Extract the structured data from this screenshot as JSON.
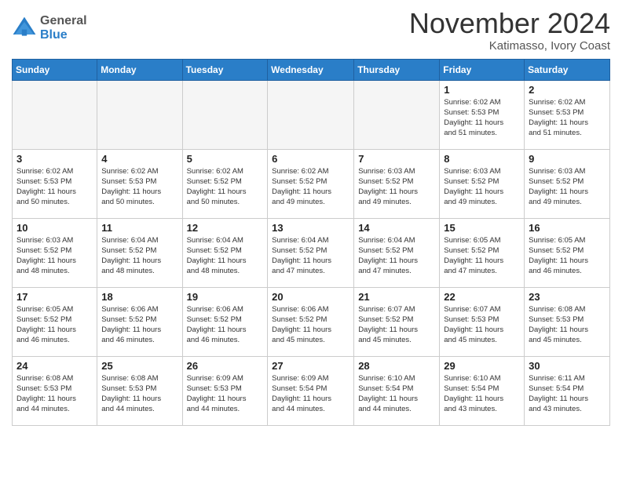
{
  "header": {
    "logo_line1": "General",
    "logo_line2": "Blue",
    "month": "November 2024",
    "location": "Katimasso, Ivory Coast"
  },
  "weekdays": [
    "Sunday",
    "Monday",
    "Tuesday",
    "Wednesday",
    "Thursday",
    "Friday",
    "Saturday"
  ],
  "weeks": [
    [
      {
        "day": "",
        "info": ""
      },
      {
        "day": "",
        "info": ""
      },
      {
        "day": "",
        "info": ""
      },
      {
        "day": "",
        "info": ""
      },
      {
        "day": "",
        "info": ""
      },
      {
        "day": "1",
        "info": "Sunrise: 6:02 AM\nSunset: 5:53 PM\nDaylight: 11 hours\nand 51 minutes."
      },
      {
        "day": "2",
        "info": "Sunrise: 6:02 AM\nSunset: 5:53 PM\nDaylight: 11 hours\nand 51 minutes."
      }
    ],
    [
      {
        "day": "3",
        "info": "Sunrise: 6:02 AM\nSunset: 5:53 PM\nDaylight: 11 hours\nand 50 minutes."
      },
      {
        "day": "4",
        "info": "Sunrise: 6:02 AM\nSunset: 5:53 PM\nDaylight: 11 hours\nand 50 minutes."
      },
      {
        "day": "5",
        "info": "Sunrise: 6:02 AM\nSunset: 5:52 PM\nDaylight: 11 hours\nand 50 minutes."
      },
      {
        "day": "6",
        "info": "Sunrise: 6:02 AM\nSunset: 5:52 PM\nDaylight: 11 hours\nand 49 minutes."
      },
      {
        "day": "7",
        "info": "Sunrise: 6:03 AM\nSunset: 5:52 PM\nDaylight: 11 hours\nand 49 minutes."
      },
      {
        "day": "8",
        "info": "Sunrise: 6:03 AM\nSunset: 5:52 PM\nDaylight: 11 hours\nand 49 minutes."
      },
      {
        "day": "9",
        "info": "Sunrise: 6:03 AM\nSunset: 5:52 PM\nDaylight: 11 hours\nand 49 minutes."
      }
    ],
    [
      {
        "day": "10",
        "info": "Sunrise: 6:03 AM\nSunset: 5:52 PM\nDaylight: 11 hours\nand 48 minutes."
      },
      {
        "day": "11",
        "info": "Sunrise: 6:04 AM\nSunset: 5:52 PM\nDaylight: 11 hours\nand 48 minutes."
      },
      {
        "day": "12",
        "info": "Sunrise: 6:04 AM\nSunset: 5:52 PM\nDaylight: 11 hours\nand 48 minutes."
      },
      {
        "day": "13",
        "info": "Sunrise: 6:04 AM\nSunset: 5:52 PM\nDaylight: 11 hours\nand 47 minutes."
      },
      {
        "day": "14",
        "info": "Sunrise: 6:04 AM\nSunset: 5:52 PM\nDaylight: 11 hours\nand 47 minutes."
      },
      {
        "day": "15",
        "info": "Sunrise: 6:05 AM\nSunset: 5:52 PM\nDaylight: 11 hours\nand 47 minutes."
      },
      {
        "day": "16",
        "info": "Sunrise: 6:05 AM\nSunset: 5:52 PM\nDaylight: 11 hours\nand 46 minutes."
      }
    ],
    [
      {
        "day": "17",
        "info": "Sunrise: 6:05 AM\nSunset: 5:52 PM\nDaylight: 11 hours\nand 46 minutes."
      },
      {
        "day": "18",
        "info": "Sunrise: 6:06 AM\nSunset: 5:52 PM\nDaylight: 11 hours\nand 46 minutes."
      },
      {
        "day": "19",
        "info": "Sunrise: 6:06 AM\nSunset: 5:52 PM\nDaylight: 11 hours\nand 46 minutes."
      },
      {
        "day": "20",
        "info": "Sunrise: 6:06 AM\nSunset: 5:52 PM\nDaylight: 11 hours\nand 45 minutes."
      },
      {
        "day": "21",
        "info": "Sunrise: 6:07 AM\nSunset: 5:52 PM\nDaylight: 11 hours\nand 45 minutes."
      },
      {
        "day": "22",
        "info": "Sunrise: 6:07 AM\nSunset: 5:53 PM\nDaylight: 11 hours\nand 45 minutes."
      },
      {
        "day": "23",
        "info": "Sunrise: 6:08 AM\nSunset: 5:53 PM\nDaylight: 11 hours\nand 45 minutes."
      }
    ],
    [
      {
        "day": "24",
        "info": "Sunrise: 6:08 AM\nSunset: 5:53 PM\nDaylight: 11 hours\nand 44 minutes."
      },
      {
        "day": "25",
        "info": "Sunrise: 6:08 AM\nSunset: 5:53 PM\nDaylight: 11 hours\nand 44 minutes."
      },
      {
        "day": "26",
        "info": "Sunrise: 6:09 AM\nSunset: 5:53 PM\nDaylight: 11 hours\nand 44 minutes."
      },
      {
        "day": "27",
        "info": "Sunrise: 6:09 AM\nSunset: 5:54 PM\nDaylight: 11 hours\nand 44 minutes."
      },
      {
        "day": "28",
        "info": "Sunrise: 6:10 AM\nSunset: 5:54 PM\nDaylight: 11 hours\nand 44 minutes."
      },
      {
        "day": "29",
        "info": "Sunrise: 6:10 AM\nSunset: 5:54 PM\nDaylight: 11 hours\nand 43 minutes."
      },
      {
        "day": "30",
        "info": "Sunrise: 6:11 AM\nSunset: 5:54 PM\nDaylight: 11 hours\nand 43 minutes."
      }
    ]
  ]
}
